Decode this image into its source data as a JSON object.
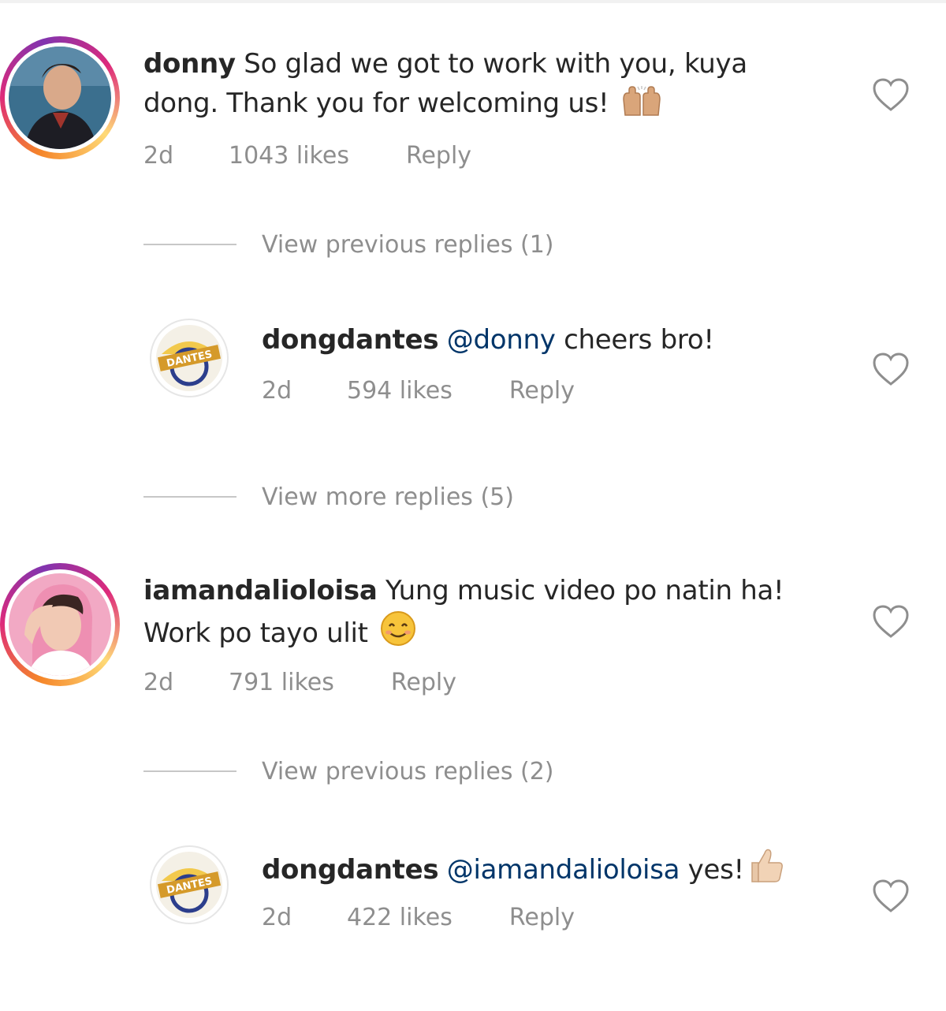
{
  "comments": [
    {
      "username": "donny",
      "text": "So glad we got to work with you, kuya dong. Thank you for welcoming us!",
      "emoji": "raising-hands",
      "time": "2d",
      "likes": "1043 likes",
      "reply_label": "Reply",
      "view_replies": "View previous replies (1)",
      "reply": {
        "username": "dongdantes",
        "mention": "@donny",
        "text": "cheers bro!",
        "time": "2d",
        "likes": "594 likes",
        "reply_label": "Reply"
      }
    },
    {
      "more_replies": "View more replies (5)"
    },
    {
      "username": "iamandalioloisa",
      "text": "Yung music video po natin ha! Work po tayo ulit",
      "emoji": "smiling-face",
      "time": "2d",
      "likes": "791 likes",
      "reply_label": "Reply",
      "view_replies": "View previous replies (2)",
      "reply": {
        "username": "dongdantes",
        "mention": "@iamandalioloisa",
        "text": "yes!",
        "emoji": "thumbs-up",
        "time": "2d",
        "likes": "422 likes",
        "reply_label": "Reply"
      }
    }
  ],
  "colors": {
    "text": "#262626",
    "muted": "#8e8e8e",
    "mention": "#003569"
  }
}
